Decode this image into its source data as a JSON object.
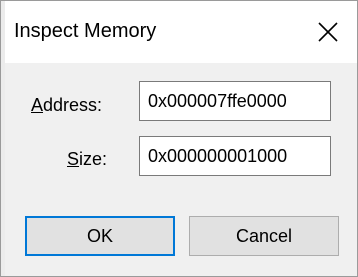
{
  "dialog": {
    "title": "Inspect Memory"
  },
  "fields": {
    "address": {
      "label_key": "A",
      "label_rest": "ddress:",
      "value": "0x000007ffe0000"
    },
    "size": {
      "label_key": "S",
      "label_rest": "ize:",
      "value": "0x000000001000"
    }
  },
  "buttons": {
    "ok_label": "OK",
    "cancel_label": "Cancel"
  },
  "icons": {
    "close": "close-icon"
  },
  "colors": {
    "default_button_border": "#0078d7",
    "button_face": "#e1e1e1",
    "client_background": "#f0f0f0"
  }
}
